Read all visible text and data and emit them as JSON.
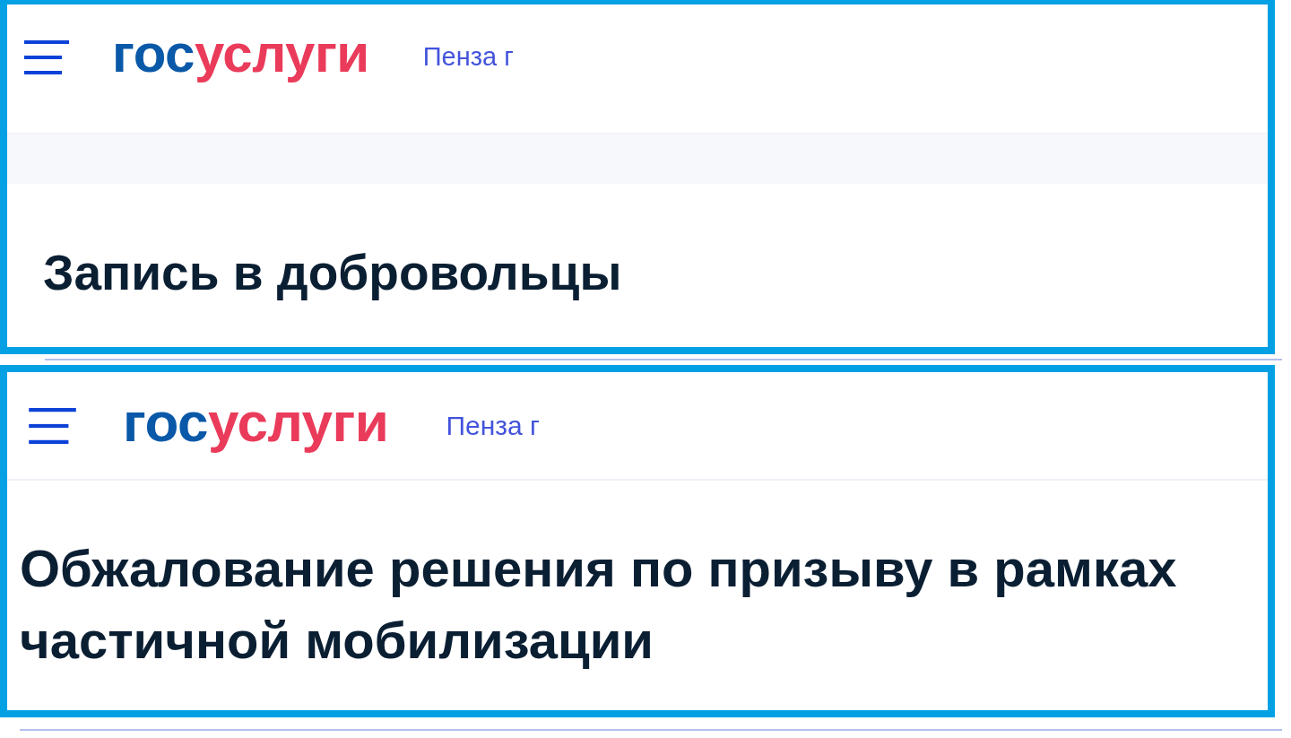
{
  "panels": [
    {
      "kind": "banded",
      "header": {
        "logo": {
          "first": "гос",
          "second": "услуги"
        },
        "location": "Пенза г"
      },
      "title": "Запись в добровольцы"
    },
    {
      "kind": "plain",
      "header": {
        "logo": {
          "first": "гос",
          "second": "услуги"
        },
        "location": "Пенза г"
      },
      "title": "Обжалование решения по призыву в рамках частичной мобилизации"
    }
  ]
}
